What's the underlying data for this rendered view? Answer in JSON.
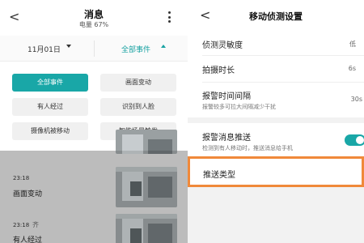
{
  "left": {
    "header": {
      "back": "<",
      "title": "消息",
      "battery": "电量 67%"
    },
    "filter": {
      "date": "11月01日",
      "event": "全部事件"
    },
    "chips": [
      {
        "label": "全部事件",
        "active": true
      },
      {
        "label": "画面变动",
        "active": false
      },
      {
        "label": "有人经过",
        "active": false
      },
      {
        "label": "识别到人脸",
        "active": false
      },
      {
        "label": "摄像机被移动",
        "active": false
      },
      {
        "label": "智能场景触发",
        "active": false
      }
    ],
    "events": [
      {
        "time": "23:18",
        "label": "画面变动",
        "extra": ""
      },
      {
        "time": "23:18",
        "label": "有人经过",
        "extra": "齐"
      }
    ]
  },
  "right": {
    "header": {
      "back": "<",
      "title": "移动侦测设置"
    },
    "rows": {
      "sensitivity": {
        "label": "侦测灵敏度",
        "value": "低"
      },
      "duration": {
        "label": "拍摄时长",
        "value": "6s"
      },
      "interval": {
        "label": "报警时间间隔",
        "sub": "报警较多可拉大间隔减少干扰",
        "value": "30s"
      },
      "push": {
        "label": "报警消息推送",
        "sub": "检测到有人移动时，推送消息给手机",
        "enabled": true
      },
      "push_type": {
        "label": "推送类型"
      }
    },
    "colors": {
      "accent": "#19a7a7",
      "highlight": "#f0893a"
    }
  }
}
